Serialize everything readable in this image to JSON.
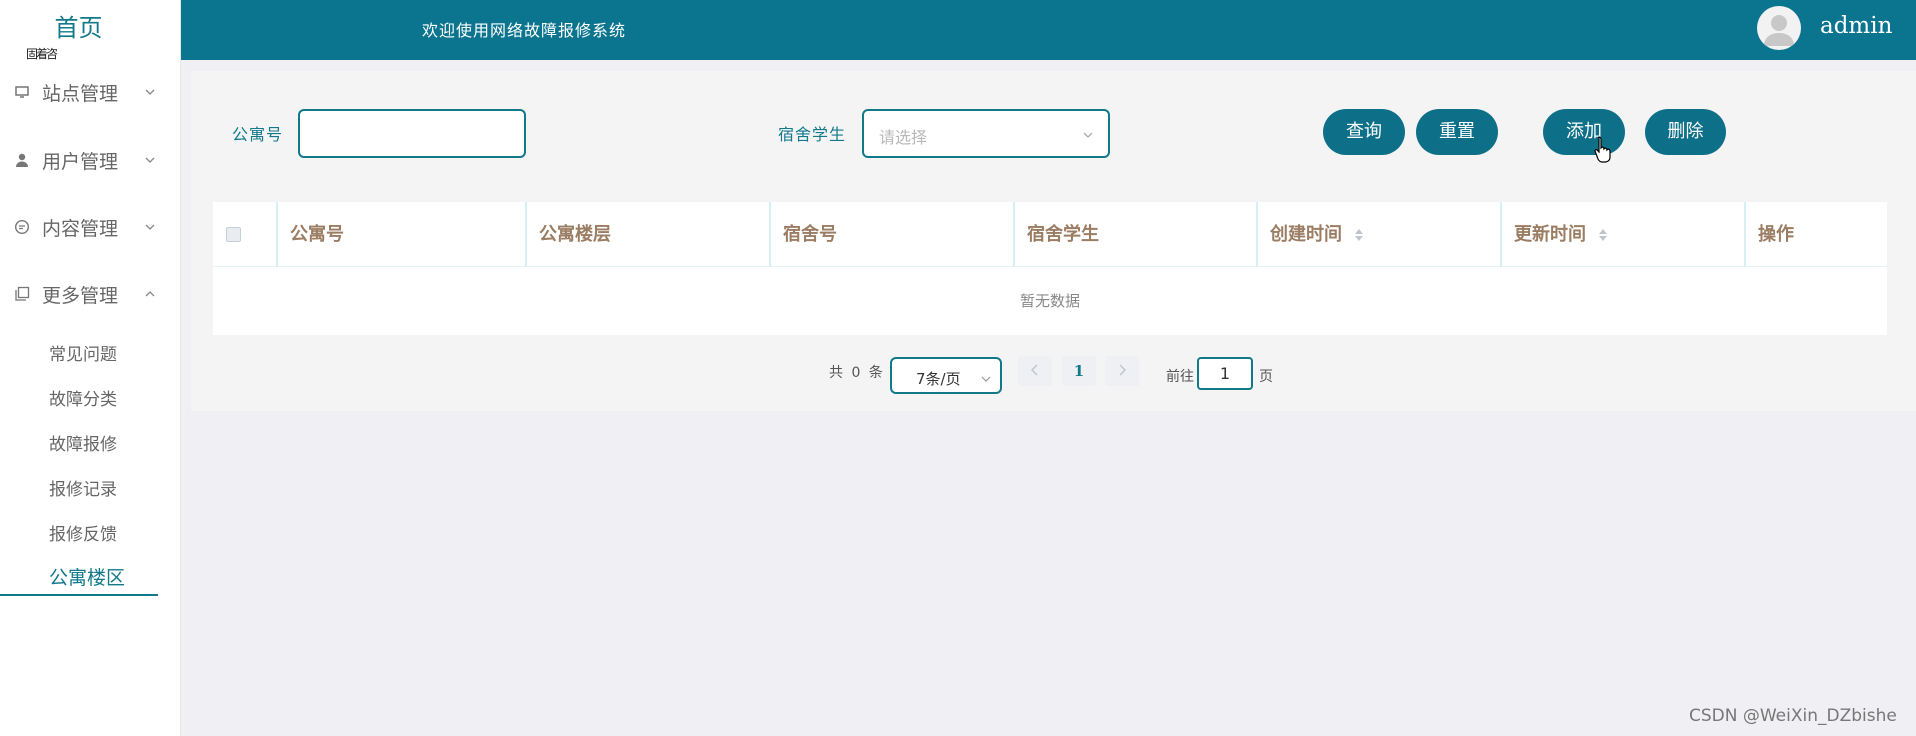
{
  "sidebar": {
    "home": "首页",
    "garbled": "固着咨",
    "groups": [
      {
        "label": "站点管理",
        "icon": "monitor-icon",
        "expanded": false
      },
      {
        "label": "用户管理",
        "icon": "user-icon",
        "expanded": false
      },
      {
        "label": "内容管理",
        "icon": "chat-icon",
        "expanded": false
      },
      {
        "label": "更多管理",
        "icon": "copy-icon",
        "expanded": true
      }
    ],
    "sub_items": [
      "常见问题",
      "故障分类",
      "故障报修",
      "报修记录",
      "报修反馈",
      "公寓楼区"
    ],
    "active_item": "公寓楼区"
  },
  "header": {
    "welcome": "欢迎使用网络故障报修系统",
    "username": "admin",
    "background": "#0b7590"
  },
  "filters": {
    "apartment_label": "公寓号",
    "apartment_value": "",
    "student_label": "宿舍学生",
    "student_placeholder": "请选择"
  },
  "buttons": {
    "query": "查询",
    "reset": "重置",
    "add": "添加",
    "delete": "删除"
  },
  "table": {
    "columns": [
      "公寓号",
      "公寓楼层",
      "宿舍号",
      "宿舍学生",
      "创建时间",
      "更新时间",
      "操作"
    ],
    "rows": [],
    "empty_text": "暂无数据"
  },
  "pagination": {
    "total": "共 0 条",
    "page_size": "7条/页",
    "current_page": "1",
    "goto_label": "前往",
    "goto_value": "1",
    "page_suffix": "页"
  },
  "watermark": "CSDN @WeiXin_DZbishe",
  "colors": {
    "accent": "#12798b",
    "header_text": "#9b7d63",
    "button": "#0e7088"
  }
}
